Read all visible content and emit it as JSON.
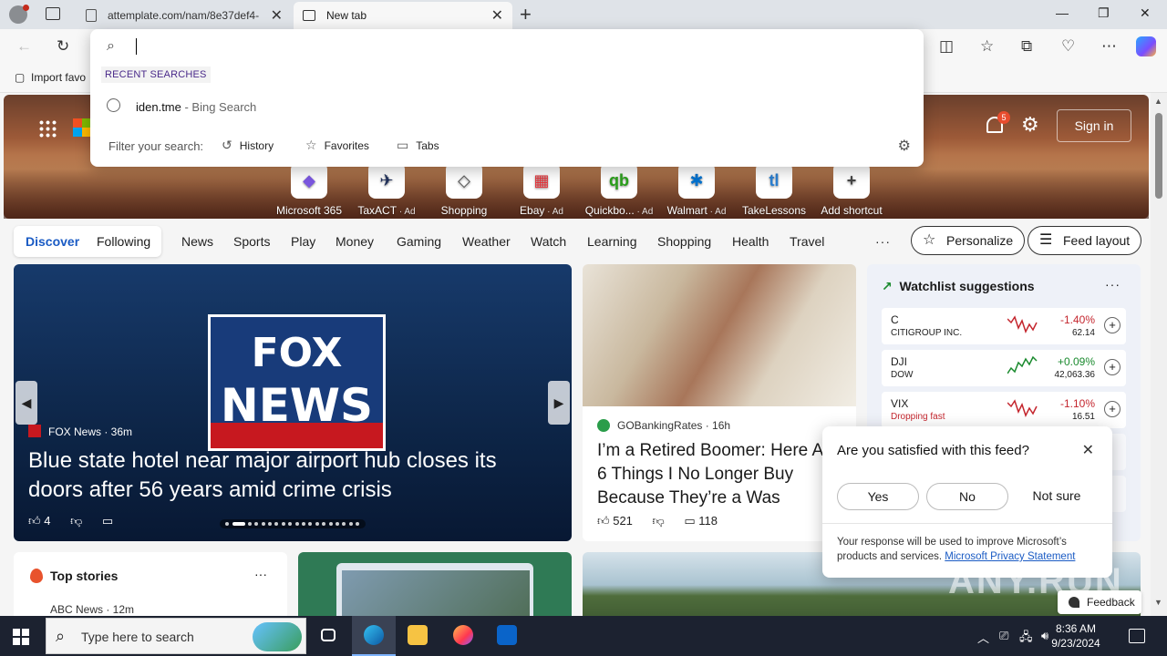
{
  "browser": {
    "tabs": [
      {
        "title": "attemplate.com/nam/8e37def4-",
        "active": false
      },
      {
        "title": "New tab",
        "active": true
      }
    ],
    "favorites_import": "Import favo"
  },
  "address_dropdown": {
    "value": "",
    "recent_label": "RECENT SEARCHES",
    "recent": [
      {
        "query": "iden.tme",
        "source": " - Bing Search"
      }
    ],
    "filter_label": "Filter your search:",
    "filters": [
      "History",
      "Favorites",
      "Tabs"
    ]
  },
  "header": {
    "notification_count": "5",
    "sign_in": "Sign in"
  },
  "shortcuts": [
    {
      "label": "Microsoft 365",
      "ad": "",
      "icon": "microsoft365-icon",
      "color": "#7b57e0"
    },
    {
      "label": "TaxACT",
      "ad": "Ad",
      "icon": "taxact-icon",
      "color": "#1f2f5a"
    },
    {
      "label": "Shopping",
      "ad": "",
      "icon": "shopping-tag-icon",
      "color": "#555555"
    },
    {
      "label": "Ebay",
      "ad": "Ad",
      "icon": "ebay-icon",
      "color": "#e53238"
    },
    {
      "label": "Quickbo...",
      "ad": "Ad",
      "icon": "quickbooks-icon",
      "color": "#2ca01c"
    },
    {
      "label": "Walmart",
      "ad": "Ad",
      "icon": "walmart-icon",
      "color": "#0071ce"
    },
    {
      "label": "TakeLessons",
      "ad": "",
      "icon": "takelessons-icon",
      "color": "#2a7fd1"
    },
    {
      "label": "Add shortcut",
      "ad": "",
      "icon": "plus-icon",
      "color": "#444444"
    }
  ],
  "feed_nav": {
    "pill": [
      "Discover",
      "Following"
    ],
    "items": [
      "News",
      "Sports",
      "Play",
      "Money",
      "Gaming",
      "Weather",
      "Watch",
      "Learning",
      "Shopping",
      "Health",
      "Travel"
    ],
    "more": "···",
    "personalize": "Personalize",
    "feed_layout": "Feed layout"
  },
  "lead_story": {
    "source": "FOX News · 36m",
    "logo_line1": "FOX",
    "logo_line2": "NEWS",
    "headline": "Blue state hotel near major airport hub closes its doors after 56 years amid crime crisis",
    "likes": "4"
  },
  "story2": {
    "source": "GOBankingRates · 16h",
    "headline": "I’m a Retired Boomer: Here Are 6 Things I No Longer Buy Because They’re a Was",
    "likes": "521",
    "comments": "118"
  },
  "watchlist": {
    "title": "Watchlist suggestions",
    "stocks": [
      {
        "symbol": "C",
        "name": "CITIGROUP INC.",
        "change": "-1.40%",
        "price": "62.14",
        "dir": "down"
      },
      {
        "symbol": "DJI",
        "name": "DOW",
        "change": "+0.09%",
        "price": "42,063.36",
        "dir": "up"
      },
      {
        "symbol": "VIX",
        "name": "Dropping fast",
        "change": "-1.10%",
        "price": "16.51",
        "dir": "down"
      }
    ],
    "colors": {
      "up": "#1a8a2e",
      "down": "#c4262e"
    }
  },
  "top_stories": {
    "title": "Top stories",
    "first_source": "ABC News · 12m"
  },
  "feedback_popup": {
    "question": "Are you satisfied with this feed?",
    "yes": "Yes",
    "no": "No",
    "not_sure": "Not sure",
    "note": "Your response will be used to improve Microsoft’s products and services.",
    "link": "Microsoft Privacy Statement"
  },
  "feedback_button": "Feedback",
  "watermark": "ANY.RUN",
  "taskbar": {
    "search_placeholder": "Type here to search",
    "time": "8:36 AM",
    "date": "9/23/2024"
  }
}
